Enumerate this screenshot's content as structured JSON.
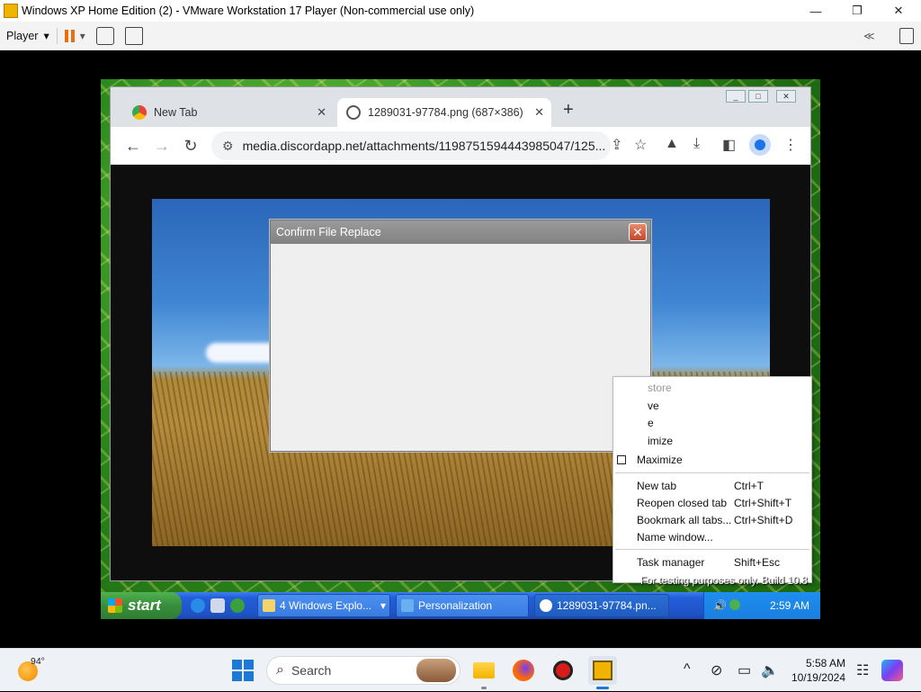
{
  "vm_window": {
    "title": "Windows XP Home Edition (2) - VMware Workstation 17 Player (Non-commercial use only)",
    "minimize_glyph": "—",
    "restore_glyph": "❐",
    "close_glyph": "✕"
  },
  "vm_toolbar": {
    "player_label": "Player",
    "dropdown_glyph": "▾",
    "collapse_glyph": "≪"
  },
  "chrome": {
    "tabs": [
      {
        "title": "New Tab",
        "close": "✕"
      },
      {
        "title": "1289031-97784.png (687×386)",
        "close": "✕"
      }
    ],
    "new_tab_glyph": "+",
    "back_glyph": "←",
    "forward_glyph": "→",
    "reload_glyph": "↻",
    "url": "media.discordapp.net/attachments/1198751594443985047/125...",
    "menu_glyph": "⋮"
  },
  "dialog": {
    "title": "Confirm File Replace",
    "close_glyph": "✕"
  },
  "context_menu": {
    "items": [
      {
        "label": "store",
        "shortcut": ""
      },
      {
        "label": "ve",
        "shortcut": ""
      },
      {
        "label": "e",
        "shortcut": ""
      },
      {
        "label": "imize",
        "shortcut": ""
      },
      {
        "label": "Maximize",
        "shortcut": ""
      },
      {
        "label": "New tab",
        "shortcut": "Ctrl+T"
      },
      {
        "label": "Reopen closed tab",
        "shortcut": "Ctrl+Shift+T"
      },
      {
        "label": "Bookmark all tabs...",
        "shortcut": "Ctrl+Shift+D"
      },
      {
        "label": "Name window...",
        "shortcut": ""
      },
      {
        "label": "Task manager",
        "shortcut": "Shift+Esc"
      }
    ]
  },
  "xp": {
    "start_label": "start",
    "tasks": [
      {
        "label": "4 Windows Explo...",
        "dropdown": "▾"
      },
      {
        "label": "Personalization",
        "dropdown": ""
      },
      {
        "label": "1289031-97784.pn...",
        "dropdown": ""
      }
    ],
    "clock": "2:59 AM",
    "watermark": "For testing purposes only. Build 10.8"
  },
  "host_taskbar": {
    "weather_temp": "94°",
    "search_placeholder": "Search",
    "time": "5:58 AM",
    "date": "10/19/2024",
    "tray_chevron": "^"
  },
  "colors": {
    "xp_taskbar": "#245edb",
    "xp_start": "#388e3c",
    "chrome_tabstrip": "#dee1e6",
    "vm_pause_accent": "#e8700c"
  }
}
